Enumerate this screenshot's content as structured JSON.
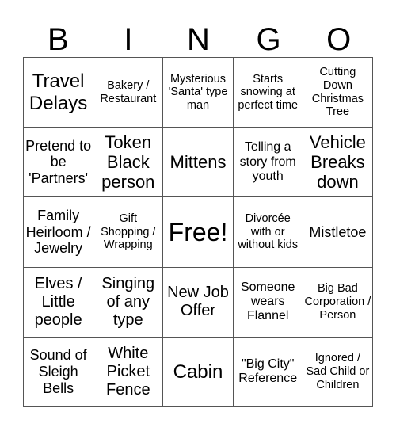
{
  "header": [
    "B",
    "I",
    "N",
    "G",
    "O"
  ],
  "cells": [
    {
      "text": "Travel Delays",
      "size": "s24"
    },
    {
      "text": "Bakery / Restaurant",
      "size": "s14"
    },
    {
      "text": "Mysterious 'Santa' type man",
      "size": "s14"
    },
    {
      "text": "Starts snowing at perfect time",
      "size": "s14"
    },
    {
      "text": "Cutting Down Christmas Tree",
      "size": "s14"
    },
    {
      "text": "Pretend to be 'Partners'",
      "size": "s18"
    },
    {
      "text": "Token Black person",
      "size": "s22"
    },
    {
      "text": "Mittens",
      "size": "s22"
    },
    {
      "text": "Telling a story from youth",
      "size": "s16"
    },
    {
      "text": "Vehicle Breaks down",
      "size": "s22"
    },
    {
      "text": "Family Heirloom / Jewelry",
      "size": "s18"
    },
    {
      "text": "Gift Shopping / Wrapping",
      "size": "s14"
    },
    {
      "text": "Free!",
      "size": "s32"
    },
    {
      "text": "Divorcée with or without kids",
      "size": "s14"
    },
    {
      "text": "Mistletoe",
      "size": "s18"
    },
    {
      "text": "Elves / Little people",
      "size": "s20"
    },
    {
      "text": "Singing of any type",
      "size": "s20"
    },
    {
      "text": "New Job Offer",
      "size": "s20"
    },
    {
      "text": "Someone wears Flannel",
      "size": "s16"
    },
    {
      "text": "Big Bad Corporation / Person",
      "size": "s14"
    },
    {
      "text": "Sound of Sleigh Bells",
      "size": "s18"
    },
    {
      "text": "White Picket Fence",
      "size": "s20"
    },
    {
      "text": "Cabin",
      "size": "s24"
    },
    {
      "text": "\"Big City\" Reference",
      "size": "s16"
    },
    {
      "text": "Ignored / Sad Child or Children",
      "size": "s14"
    }
  ]
}
